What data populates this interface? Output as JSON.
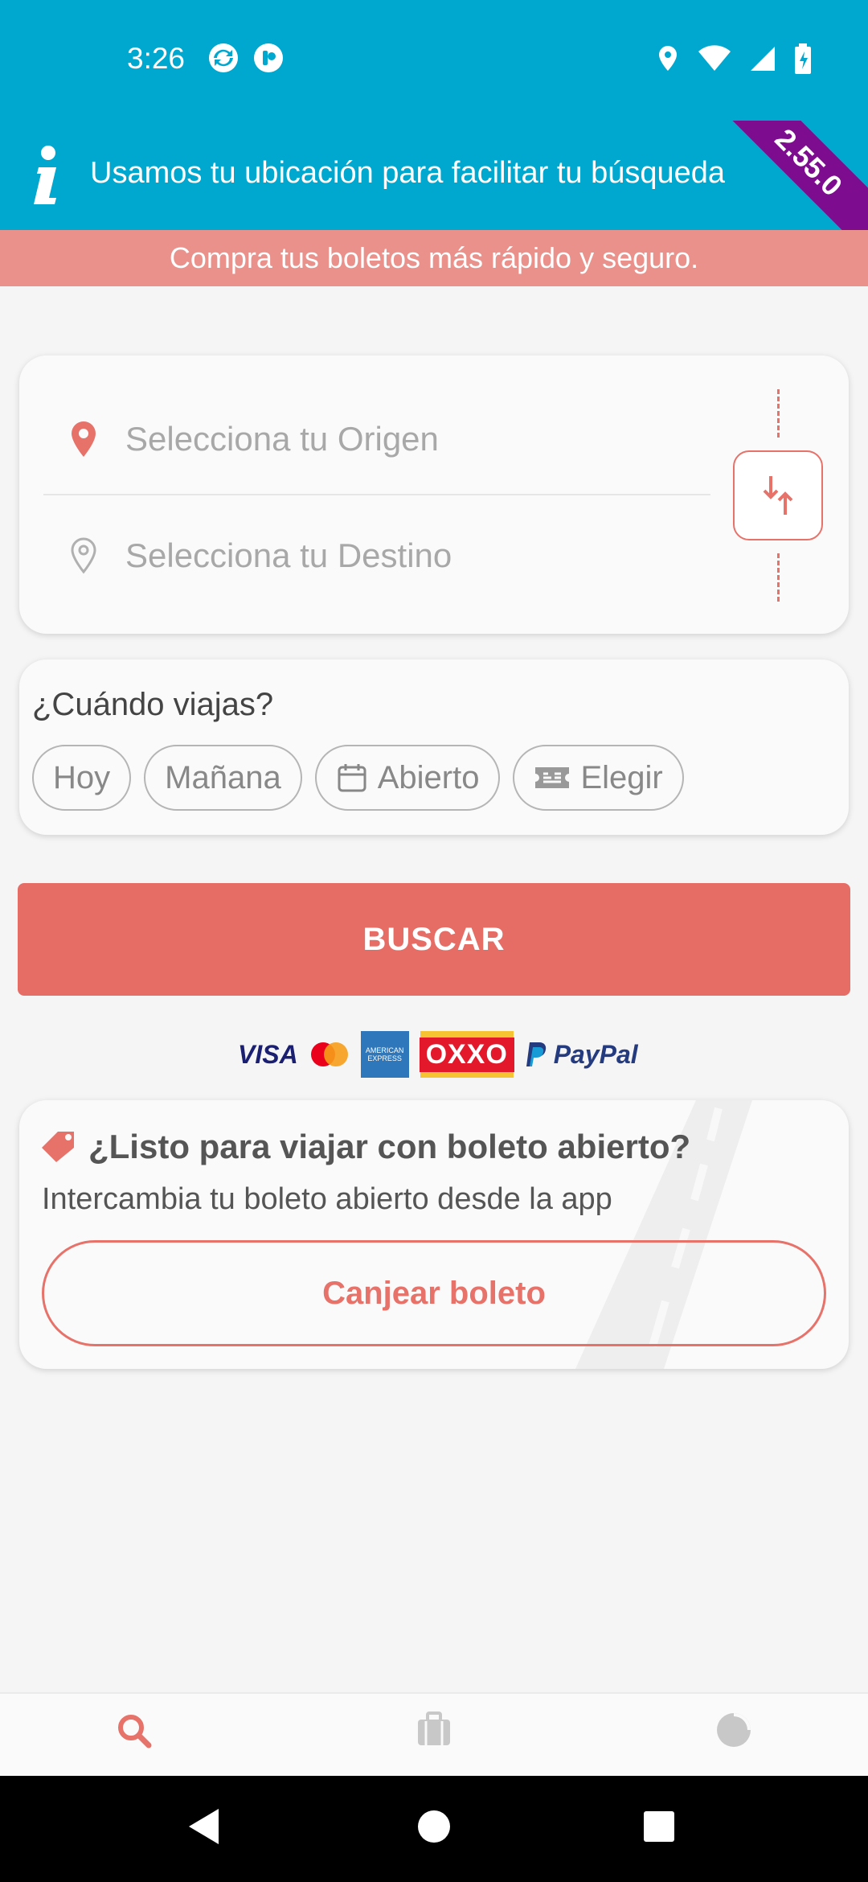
{
  "status_bar": {
    "time": "3:26",
    "icons": [
      "sync-icon",
      "app-notification-icon",
      "location-icon",
      "wifi-icon",
      "signal-icon",
      "battery-charging-icon"
    ]
  },
  "info_bar": {
    "text": "Usamos tu ubicación para facilitar tu búsqueda",
    "version_ribbon": "2.55.0"
  },
  "promo_banner": {
    "text": "Compra tus boletos más rápido y seguro."
  },
  "route": {
    "origin_placeholder": "Selecciona tu Origen",
    "destination_placeholder": "Selecciona tu Destino"
  },
  "when": {
    "label": "¿Cuándo viajas?",
    "chips": [
      {
        "label": "Hoy"
      },
      {
        "label": "Mañana"
      },
      {
        "label": "Abierto",
        "icon": "calendar-icon"
      },
      {
        "label": "Elegir",
        "icon": "ticket-icon"
      }
    ]
  },
  "search_button": {
    "label": "BUSCAR"
  },
  "payments": {
    "visa": "VISA",
    "amex": "AMERICAN EXPRESS",
    "oxxo": "OXXO",
    "paypal": "PayPal"
  },
  "open_ticket": {
    "title": "¿Listo para viajar con boleto abierto?",
    "subtitle": "Intercambia tu boleto abierto desde la app",
    "button": "Canjear boleto"
  },
  "bottom_nav": {
    "items": [
      {
        "icon": "search-icon",
        "label": "",
        "active": true
      },
      {
        "icon": "suitcase-icon",
        "label": "",
        "active": false
      },
      {
        "icon": "pie-chart-icon",
        "label": "",
        "active": false
      }
    ]
  },
  "colors": {
    "primary_blue": "#00a7cf",
    "accent_red": "#e66c66",
    "promo_pink": "#eb918b",
    "ribbon_purple": "#7d0c8e"
  }
}
